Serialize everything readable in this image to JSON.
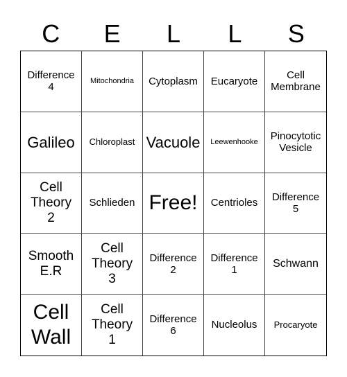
{
  "header": {
    "letters": [
      "C",
      "E",
      "L",
      "L",
      "S"
    ]
  },
  "cells": [
    "Difference 4",
    "Mitochondria",
    "Cytoplasm",
    "Eucaryote",
    "Cell Membrane",
    "Galileo",
    "Chloroplast",
    "Vacuole",
    "Leewenhooke",
    "Pinocytotic Vesicle",
    "Cell Theory 2",
    "Schlieden",
    "Free!",
    "Centrioles",
    "Difference 5",
    "Smooth E.R",
    "Cell Theory 3",
    "Difference 2",
    "Difference 1",
    "Schwann",
    "Cell Wall",
    "Cell Theory 1",
    "Difference 6",
    "Nucleolus",
    "Procaryote"
  ]
}
